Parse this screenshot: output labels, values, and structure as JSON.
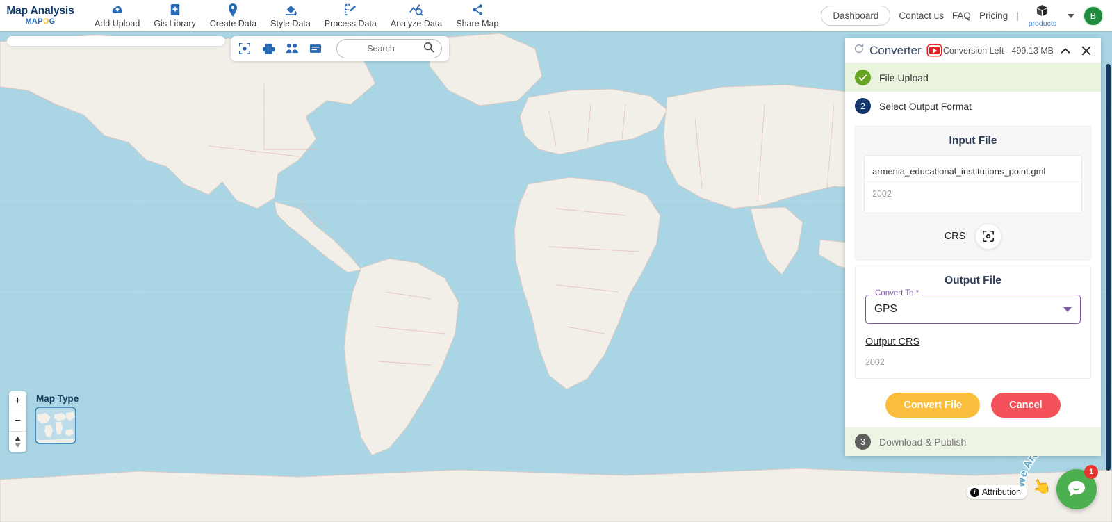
{
  "header": {
    "brand_line1": "Map Analysis",
    "brand_prefix": "MAP",
    "brand_suffix": "G",
    "brand_accent": "O",
    "nav": [
      {
        "label": "Add Upload",
        "icon": "cloud-upload-icon"
      },
      {
        "label": "Gis Library",
        "icon": "library-book-icon"
      },
      {
        "label": "Create Data",
        "icon": "map-pin-icon"
      },
      {
        "label": "Style Data",
        "icon": "paint-bucket-icon"
      },
      {
        "label": "Process Data",
        "icon": "process-edit-icon"
      },
      {
        "label": "Analyze Data",
        "icon": "analyze-chart-icon"
      },
      {
        "label": "Share Map",
        "icon": "share-icon"
      }
    ],
    "dashboard": "Dashboard",
    "contact": "Contact us",
    "faq": "FAQ",
    "pricing": "Pricing",
    "separator": "|",
    "products": "products",
    "avatar_initial": "B",
    "accent_blue": "#2a6ab5",
    "avatar_color": "#1e8a3c"
  },
  "map_toolbar": {
    "tools": [
      {
        "name": "locate-icon"
      },
      {
        "name": "print-icon"
      },
      {
        "name": "measure-icon"
      },
      {
        "name": "legend-icon"
      }
    ],
    "search_placeholder": "Search",
    "search_value": "",
    "search_icon": "search-icon"
  },
  "map_controls": {
    "zoom_in": "+",
    "zoom_out": "−",
    "compass": "⬍",
    "map_type_label": "Map Type"
  },
  "attribution": {
    "label": "Attribution",
    "icon": "info-icon"
  },
  "chat": {
    "tagline": "We Are Here!",
    "badge_count": "1",
    "icon": "chat-bubble-icon"
  },
  "panel": {
    "title": "Converter",
    "title_icon": "refresh-icon",
    "video_badge": "youtube-play-icon",
    "conversion_left": "Conversion Left - 499.13 MB",
    "collapse_icon": "chevron-up-icon",
    "close_icon": "close-icon",
    "steps": [
      {
        "badge": "✓",
        "label": "File Upload",
        "state": "done"
      },
      {
        "badge": "2",
        "label": "Select Output Format",
        "state": "active"
      },
      {
        "badge": "3",
        "label": "Download & Publish",
        "state": "future"
      }
    ],
    "input_file": {
      "card_title": "Input File",
      "file_name": "armenia_educational_institutions_point.gml",
      "file_meta": "2002",
      "crs_label": "CRS",
      "scan_icon": "scan-focus-icon"
    },
    "output_file": {
      "card_title": "Output File",
      "convert_to_label": "Convert To *",
      "convert_to_value": "GPS",
      "dropdown_icon": "chevron-down-icon",
      "output_crs_label": "Output CRS",
      "output_crs_value": "2002"
    },
    "actions": {
      "convert": "Convert File",
      "cancel": "Cancel",
      "convert_color": "#fbbe3c",
      "cancel_color": "#f4515b"
    }
  },
  "colors": {
    "map_water": "#aad5e4",
    "map_land": "#f2efe9",
    "panel_accent": "#7e57a8",
    "step_done": "#66a524",
    "step_active": "#14386b",
    "scrollbar": "#17375e"
  }
}
